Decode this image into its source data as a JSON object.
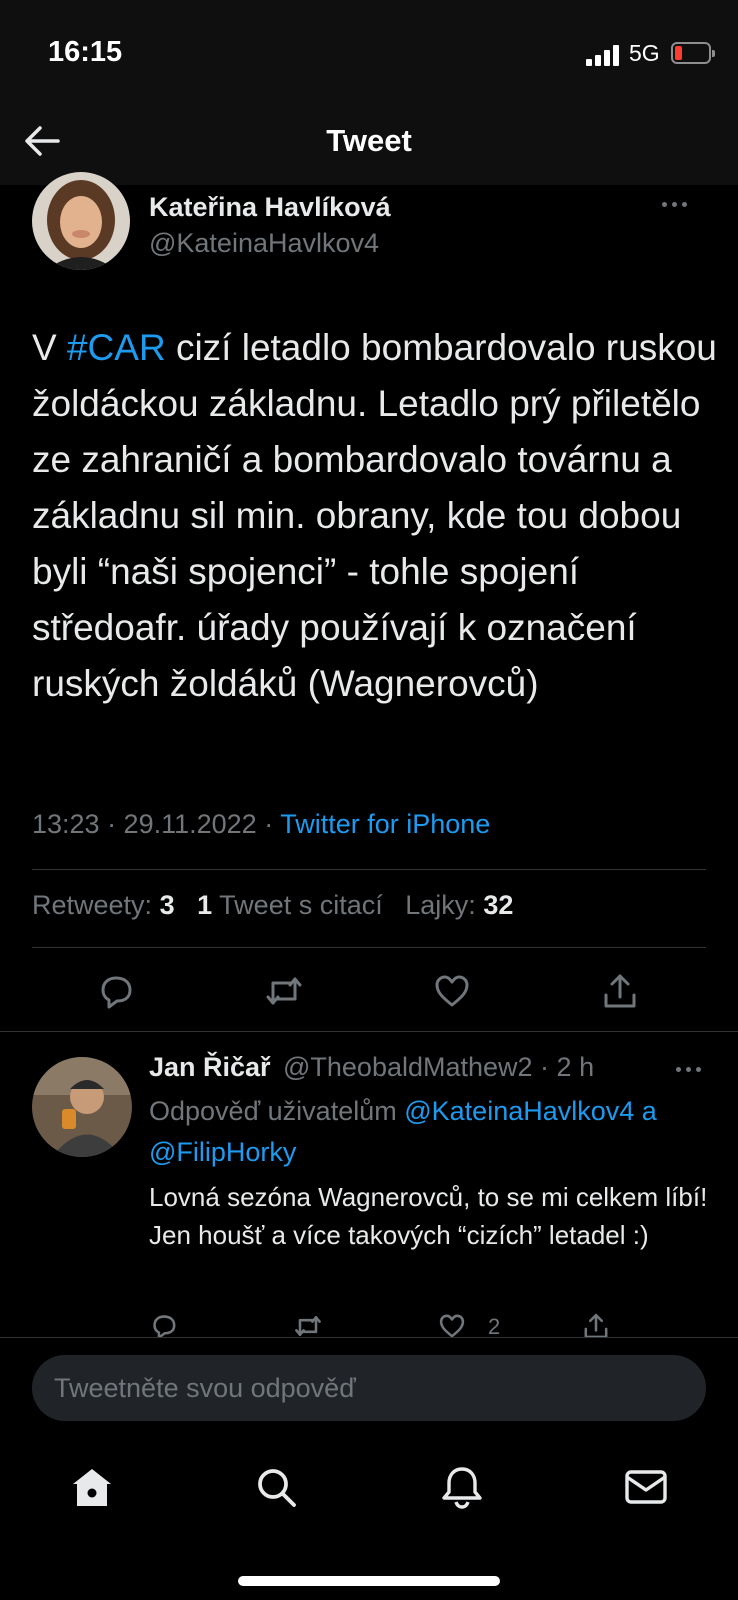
{
  "status_bar": {
    "time": "16:15",
    "network": "5G",
    "battery_color": "#ff3b30"
  },
  "header": {
    "title": "Tweet",
    "back_icon": "arrow-left-icon"
  },
  "tweet": {
    "author_name": "Kateřina Havlíková",
    "author_handle": "@KateinaHavlkov4",
    "text_before": "V ",
    "hashtag": "#CAR",
    "text_after": " cizí letadlo bombardovalo ruskou žoldáckou základnu. Letadlo prý přiletělo ze zahraničí a bombardovalo továrnu a základnu sil min. obrany, kde tou dobou byli “naši spojenci” - tohle spojení středoafr. úřady používají k označení ruských žoldáků (Wagnerovců)",
    "timestamp": "13:23 · 29.11.2022 · ",
    "source": "Twitter for iPhone",
    "stats": {
      "retweets_label": "Retweety:",
      "retweets": "3",
      "quotes": "1",
      "quotes_label": "Tweet s citací",
      "likes_label": "Lajky:",
      "likes": "32"
    }
  },
  "reply": {
    "author_name": "Jan Řičař",
    "meta": "@TheobaldMathew2 · 2 h",
    "replying_to_label": "Odpověď uživatelům",
    "mention_1": "@KateinaHavlkov4",
    "joiner": "a",
    "mention_2": "@FilipHorky",
    "text": "Lovná sezóna Wagnerovců, to se mi celkem líbí! Jen houšť a více takových “cizích” letadel :)",
    "like_count": "2"
  },
  "composer": {
    "placeholder": "Tweetněte svou odpověď"
  },
  "colors": {
    "accent": "#1d9bf0",
    "muted": "#71767b",
    "text": "#e7e9ea",
    "background": "#000000"
  }
}
